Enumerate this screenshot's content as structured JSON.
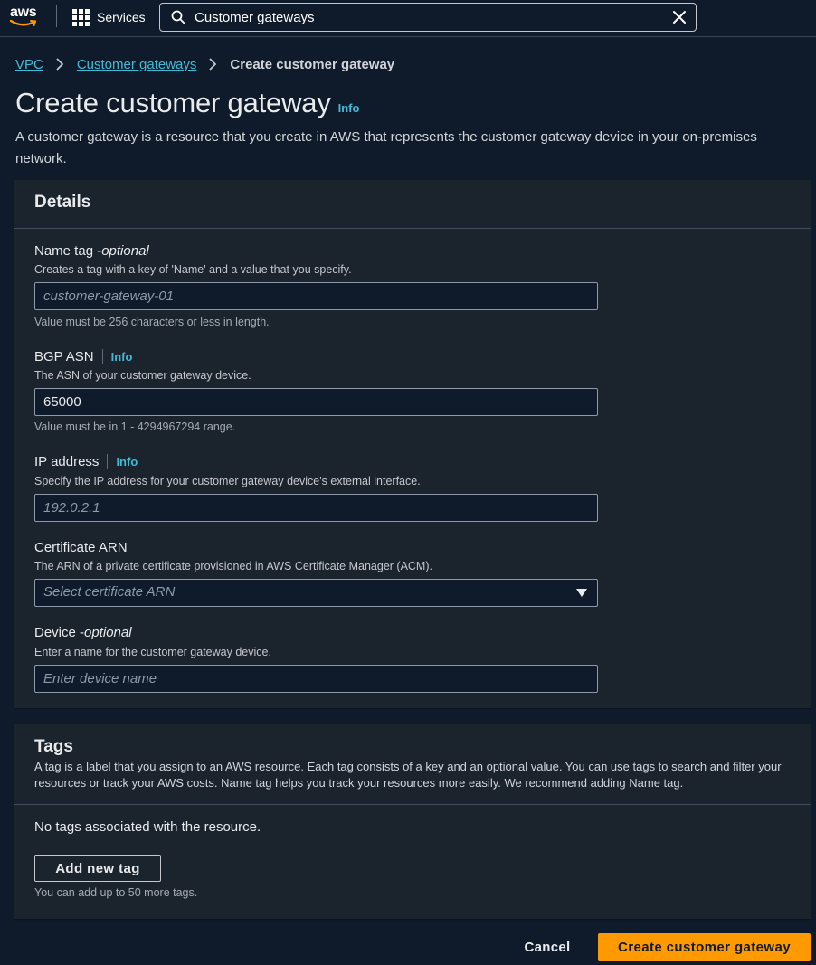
{
  "topnav": {
    "logo_text": "aws",
    "services_label": "Services",
    "search_value": "Customer gateways"
  },
  "breadcrumb": {
    "items": [
      "VPC",
      "Customer gateways"
    ],
    "current": "Create customer gateway"
  },
  "header": {
    "title": "Create customer gateway",
    "info": "Info",
    "description": "A customer gateway is a resource that you create in AWS that represents the customer gateway device in your on-premises network."
  },
  "details": {
    "title": "Details",
    "name_tag": {
      "label": "Name tag - ",
      "label_optional": "optional",
      "description": "Creates a tag with a key of 'Name' and a value that you specify.",
      "placeholder": "customer-gateway-01",
      "constraint": "Value must be 256 characters or less in length."
    },
    "bgp_asn": {
      "label": "BGP ASN",
      "info": "Info",
      "description": "The ASN of your customer gateway device.",
      "value": "65000",
      "constraint": "Value must be in 1 - 4294967294 range."
    },
    "ip_address": {
      "label": "IP address",
      "info": "Info",
      "description": "Specify the IP address for your customer gateway device's external interface.",
      "placeholder": "192.0.2.1"
    },
    "certificate_arn": {
      "label": "Certificate ARN",
      "description": "The ARN of a private certificate provisioned in AWS Certificate Manager (ACM).",
      "placeholder": "Select certificate ARN"
    },
    "device": {
      "label": "Device - ",
      "label_optional": "optional",
      "description": "Enter a name for the customer gateway device.",
      "placeholder": "Enter device name"
    }
  },
  "tags": {
    "title": "Tags",
    "description": "A tag is a label that you assign to an AWS resource. Each tag consists of a key and an optional value. You can use tags to search and filter your resources or track your AWS costs. Name tag helps you track your resources more easily. We recommend adding Name tag.",
    "empty_text": "No tags associated with the resource.",
    "add_button": "Add new tag",
    "note": "You can add up to 50 more tags."
  },
  "footer": {
    "cancel": "Cancel",
    "submit": "Create customer gateway"
  },
  "colors": {
    "background": "#0f1b2a",
    "panel": "#1b232d",
    "link": "#44b9d6",
    "primary": "#ff9900"
  }
}
